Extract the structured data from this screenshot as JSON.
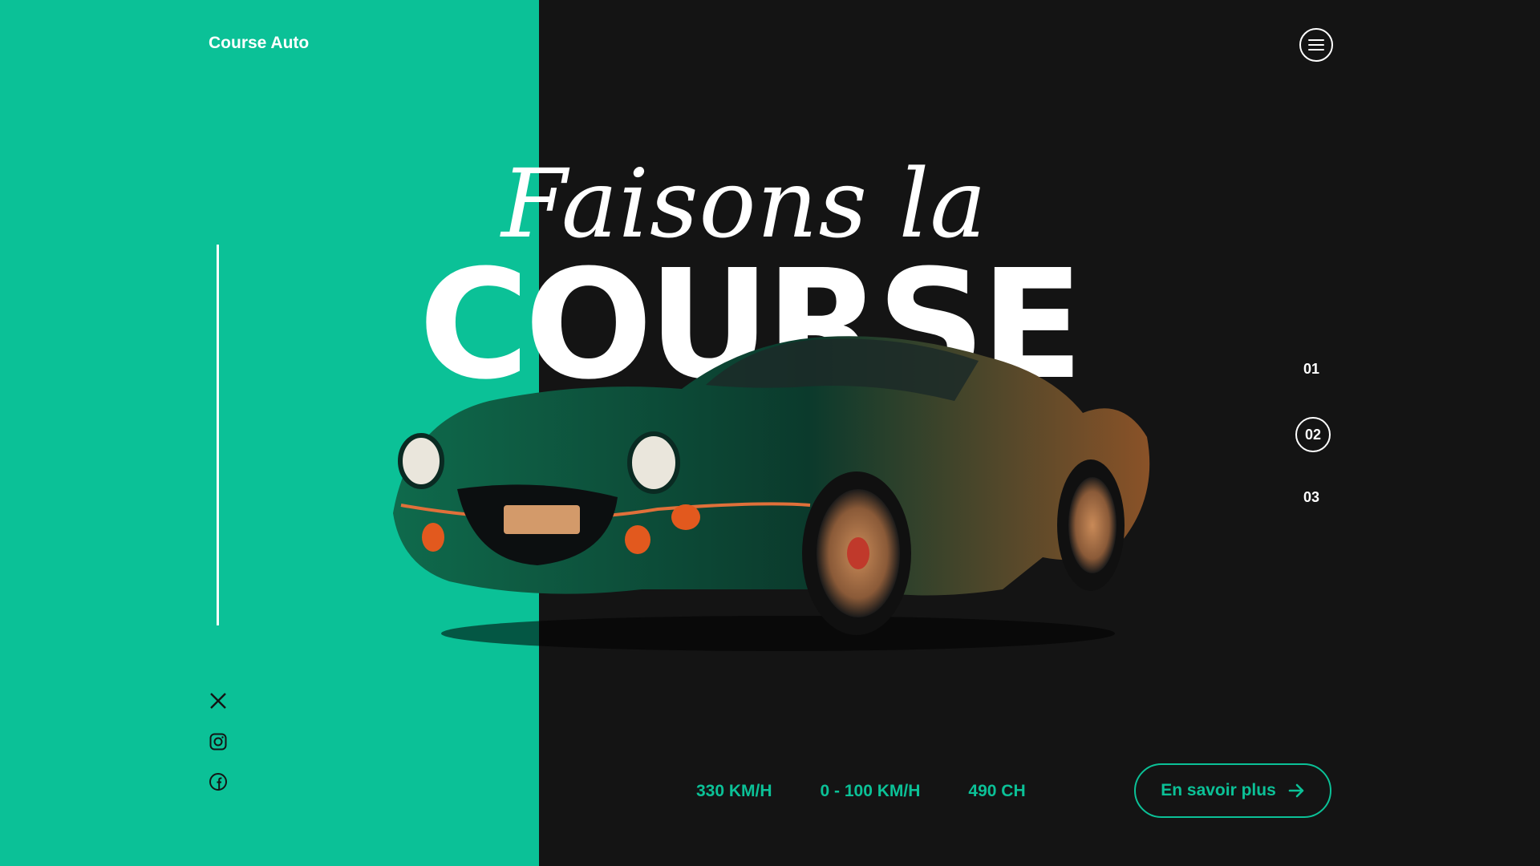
{
  "header": {
    "logo": "Course Auto",
    "menu_icon": "hamburger-menu-icon"
  },
  "hero": {
    "script_title": "Faisons la",
    "main_title": "COURSE"
  },
  "slides": {
    "items": [
      "01",
      "02",
      "03"
    ],
    "active": "02"
  },
  "social": {
    "icons": [
      "x-icon",
      "instagram-icon",
      "facebook-icon"
    ]
  },
  "specs": {
    "speed": "330 KM/H",
    "acceleration": "0 - 100 KM/H",
    "power": "490 CH"
  },
  "cta": {
    "label": "En savoir plus",
    "icon": "arrow-right-icon"
  },
  "colors": {
    "accent": "#0bc197",
    "dark": "#141414",
    "white": "#ffffff"
  }
}
